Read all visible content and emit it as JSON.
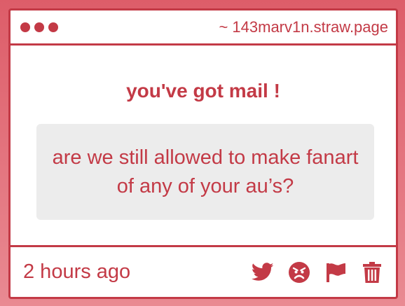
{
  "window": {
    "url": "~ 143marv1n.straw.page"
  },
  "content": {
    "heading": "you've got mail !",
    "message": "are we still allowed to make fanart of any of your au’s?"
  },
  "footer": {
    "timestamp": "2 hours ago",
    "icons": [
      "twitter-icon",
      "angry-face-icon",
      "flag-icon",
      "trash-icon"
    ]
  },
  "colors": {
    "accent": "#c33a46",
    "background_top": "#dd5d69",
    "background_bottom": "#e98a92",
    "message_box": "#ececec",
    "panel": "#ffffff"
  }
}
